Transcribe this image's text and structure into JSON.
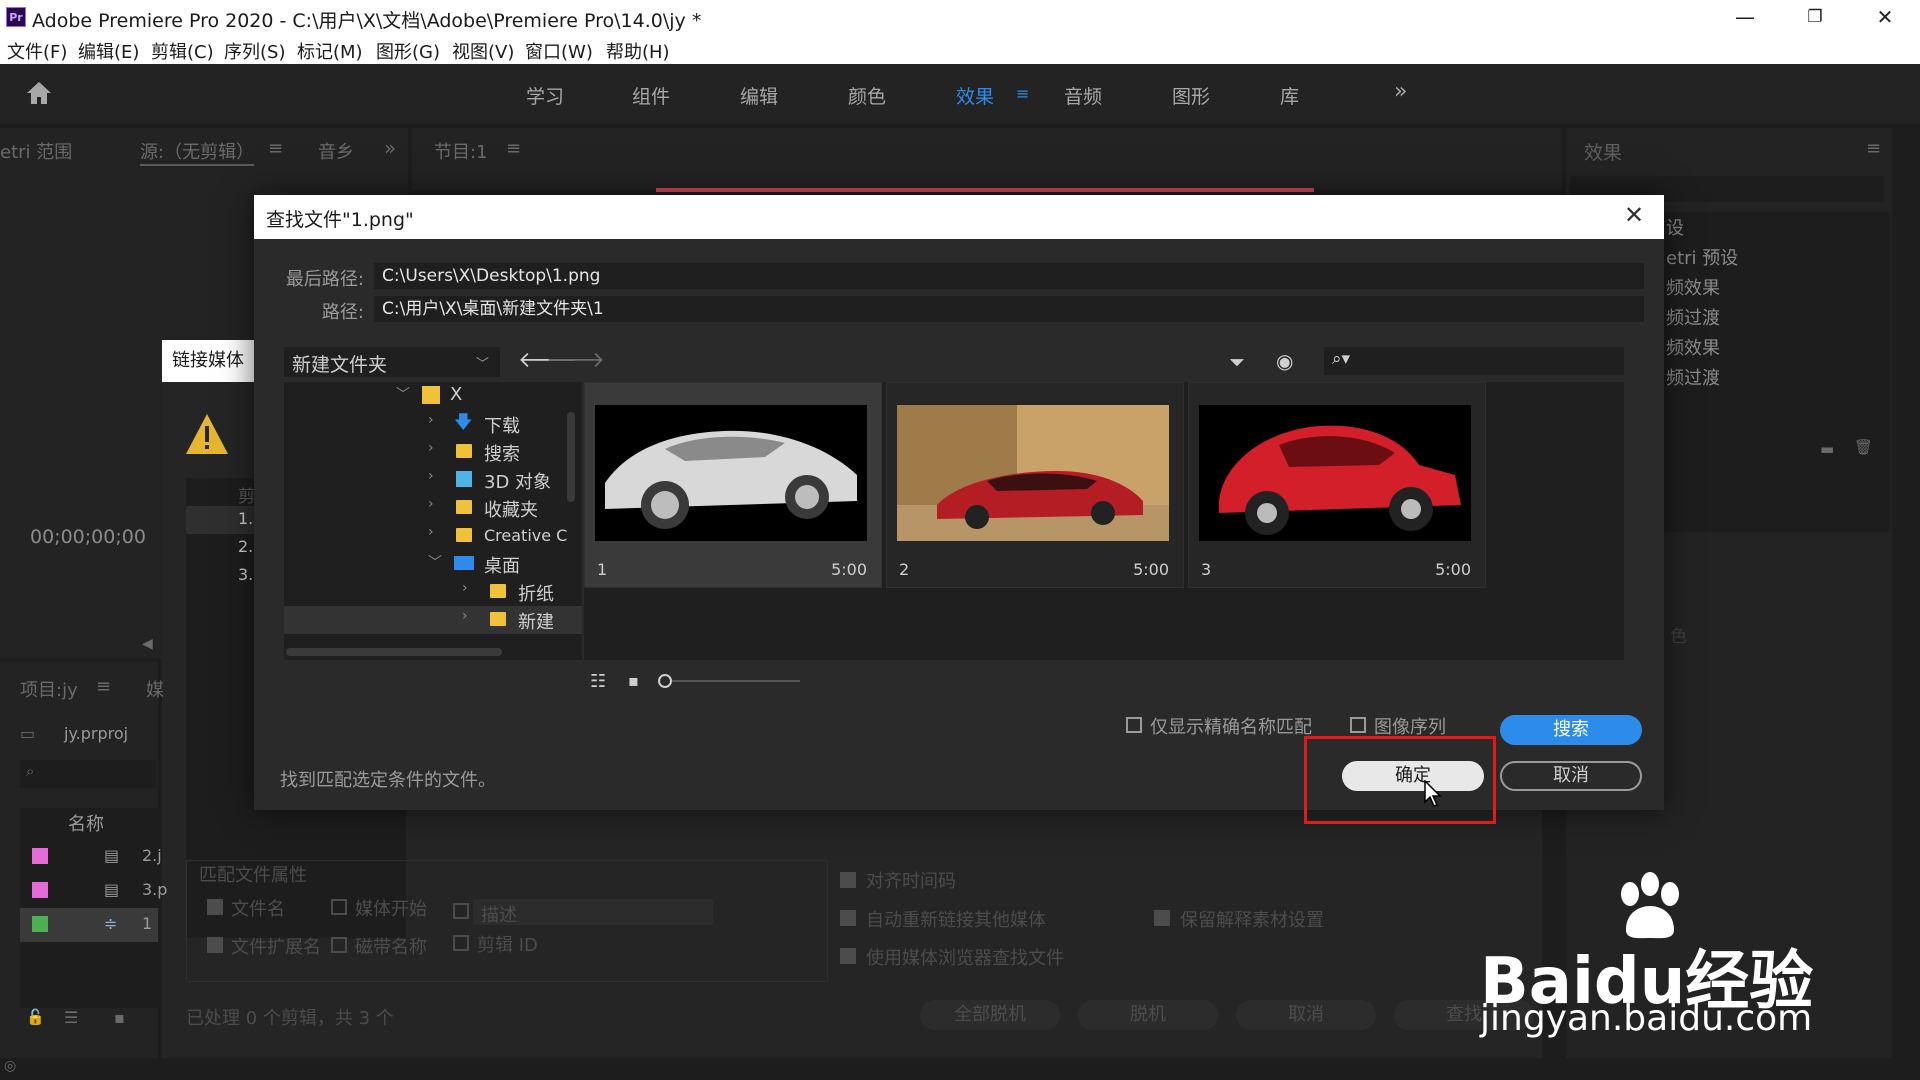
{
  "window": {
    "app_icon": "Pr",
    "title": "Adobe Premiere Pro 2020 - C:\\用户\\X\\文档\\Adobe\\Premiere Pro\\14.0\\jy *",
    "controls": [
      "minimize-icon",
      "restore-icon",
      "close-icon"
    ]
  },
  "menu": [
    "文件(F)",
    "编辑(E)",
    "剪辑(C)",
    "序列(S)",
    "标记(M)",
    "图形(G)",
    "视图(V)",
    "窗口(W)",
    "帮助(H)"
  ],
  "workspaces": {
    "items": [
      "学习",
      "组件",
      "编辑",
      "颜色",
      "效果",
      "音频",
      "图形",
      "库"
    ],
    "active": "效果",
    "more": "»"
  },
  "left_panel": {
    "tabs": [
      "etri 范围",
      "源:（无剪辑）",
      "音乡",
      "»"
    ],
    "timecode": "00;00;00;00",
    "link_media_tab": "链接媒体",
    "list_header": "剪",
    "list_items": [
      "1.",
      "2.",
      "3."
    ]
  },
  "program_panel": {
    "tab": "节目:1"
  },
  "effects_panel": {
    "title": "效果",
    "items": [
      "设",
      "etri 预设",
      "频效果",
      "频过渡",
      "频效果",
      "频过渡"
    ],
    "faded_label": "色"
  },
  "project_panel": {
    "tab": "项目:jy",
    "tab2": "媒",
    "file": "jy.prproj",
    "column": "名称",
    "rows": [
      {
        "label": "2.j",
        "color": "#e56bd6"
      },
      {
        "label": "3.p",
        "color": "#e56bd6"
      },
      {
        "label": "1",
        "color": "#4caf50"
      }
    ]
  },
  "link_media_bg": {
    "match_props_title": "匹配文件属性",
    "checks_left": [
      {
        "label": "文件名",
        "checked": true
      },
      {
        "label": "媒体开始",
        "checked": false
      },
      {
        "label": "描述",
        "checked": false
      },
      {
        "label": "文件扩展名",
        "checked": true
      },
      {
        "label": "磁带名称",
        "checked": false
      },
      {
        "label": "剪辑 ID",
        "checked": false
      }
    ],
    "checks_right": [
      {
        "label": "对齐时间码",
        "checked": true
      },
      {
        "label": "自动重新链接其他媒体",
        "checked": true
      },
      {
        "label": "保留解释素材设置",
        "checked": true
      },
      {
        "label": "使用媒体浏览器查找文件",
        "checked": true
      }
    ],
    "status": "已处理 0 个剪辑，共 3 个",
    "buttons": [
      "全部脱机",
      "脱机",
      "取消",
      "查找"
    ]
  },
  "dialog": {
    "title": "查找文件\"1.png\"",
    "last_path_label": "最后路径:",
    "last_path_value": "C:\\Users\\X\\Desktop\\1.png",
    "path_label": "路径:",
    "path_value": "C:\\用户\\X\\桌面\\新建文件夹\\1",
    "folder_dropdown": "新建文件夹",
    "search_placeholder": "",
    "tree": [
      {
        "label": "X",
        "indent": 0,
        "expanded": true,
        "icon": "user-folder-icon"
      },
      {
        "label": "下载",
        "indent": 1,
        "expanded": false,
        "icon": "download-icon"
      },
      {
        "label": "搜索",
        "indent": 1,
        "expanded": false,
        "icon": "folder-icon"
      },
      {
        "label": "3D 对象",
        "indent": 1,
        "expanded": false,
        "icon": "3d-objects-icon"
      },
      {
        "label": "收藏夹",
        "indent": 1,
        "expanded": false,
        "icon": "folder-icon"
      },
      {
        "label": "Creative C",
        "indent": 1,
        "expanded": false,
        "icon": "folder-icon"
      },
      {
        "label": "桌面",
        "indent": 1,
        "expanded": true,
        "icon": "desktop-icon"
      },
      {
        "label": "折纸",
        "indent": 2,
        "expanded": false,
        "icon": "folder-icon"
      },
      {
        "label": "新建",
        "indent": 2,
        "expanded": false,
        "icon": "folder-icon",
        "selected": true
      }
    ],
    "thumbnails": [
      {
        "number": "1",
        "duration": "5:00",
        "selected": true
      },
      {
        "number": "2",
        "duration": "5:00",
        "selected": false
      },
      {
        "number": "3",
        "duration": "5:00",
        "selected": false
      }
    ],
    "exact_match_label": "仅显示精确名称匹配",
    "image_sequence_label": "图像序列",
    "search_button": "搜索",
    "status_text": "找到匹配选定条件的文件。",
    "ok_button": "确定",
    "cancel_button": "取消",
    "colors": {
      "accent": "#2d8ceb",
      "highlight": "#e01b1b"
    }
  },
  "watermark": {
    "brand": "Baidu经验",
    "url": "jingyan.baidu.com"
  }
}
